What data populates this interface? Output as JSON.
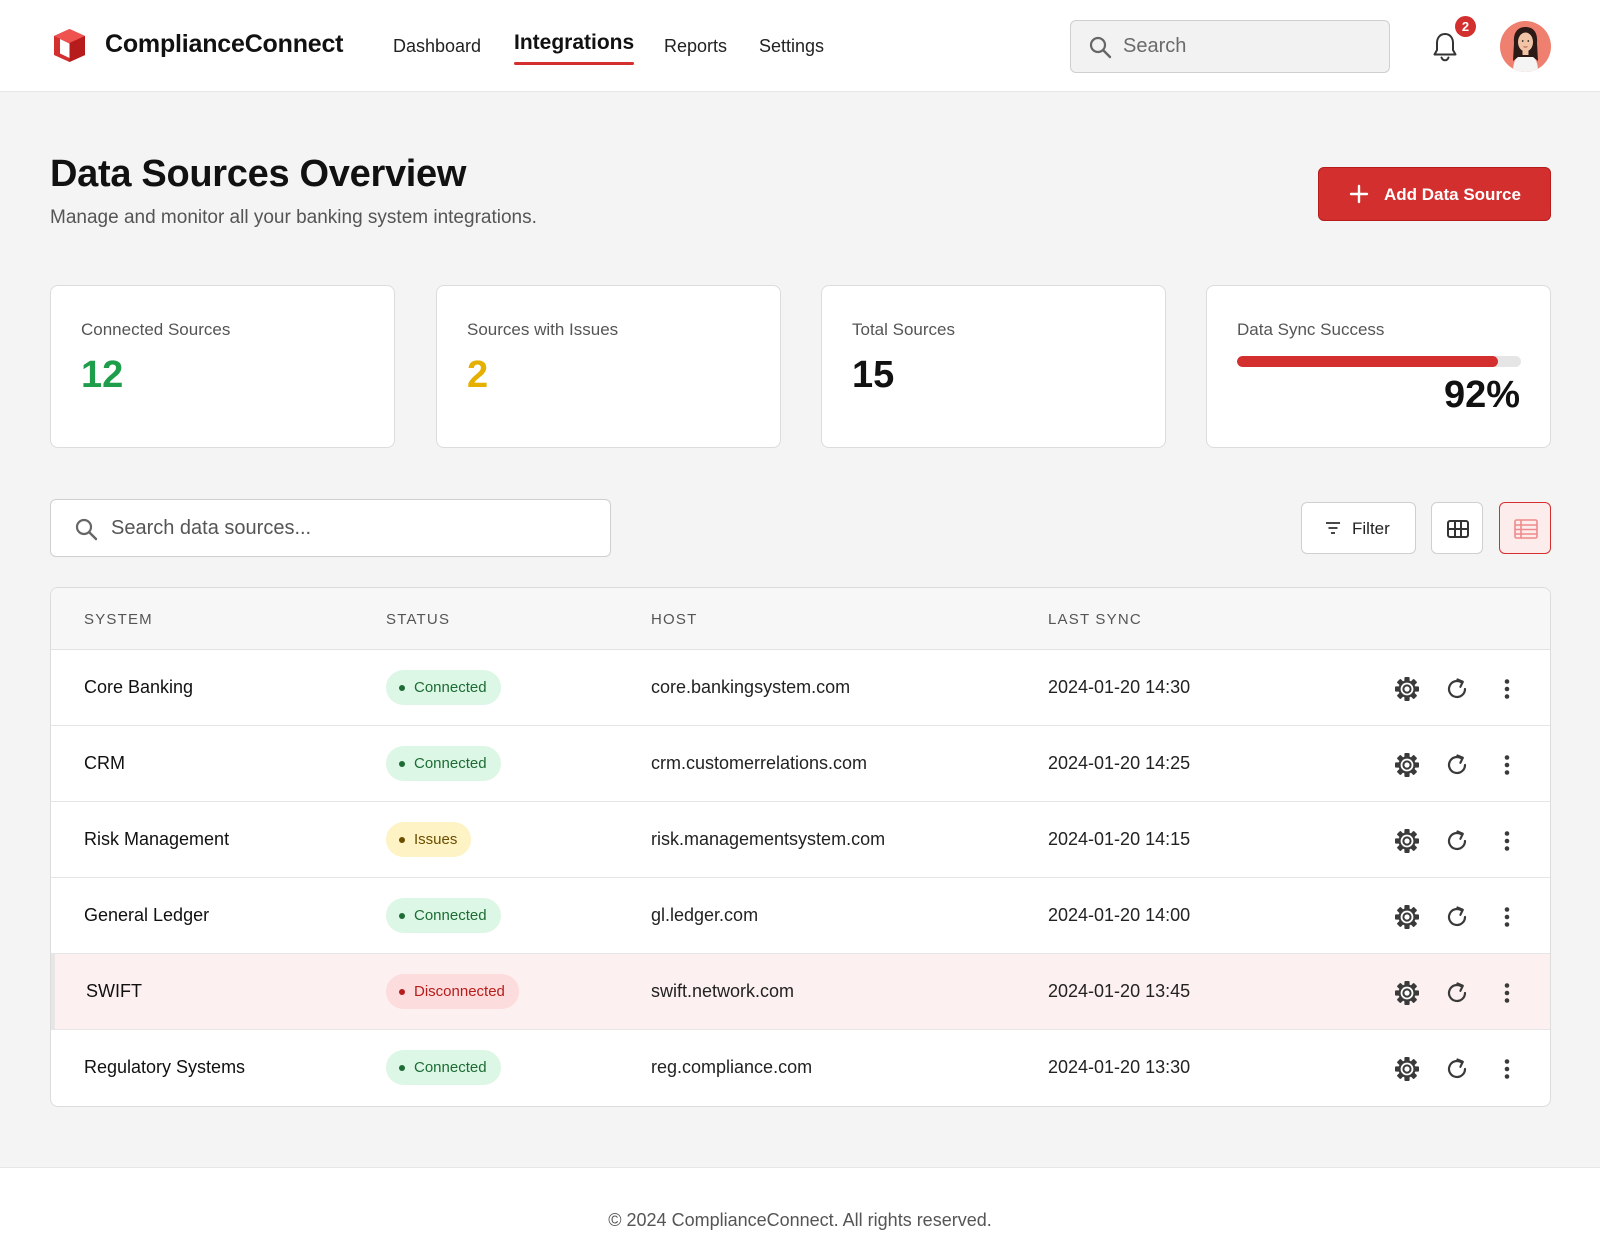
{
  "brand": {
    "name": "ComplianceConnect"
  },
  "nav": [
    {
      "label": "Dashboard"
    },
    {
      "label": "Integrations",
      "active": true
    },
    {
      "label": "Reports"
    },
    {
      "label": "Settings"
    }
  ],
  "header": {
    "search_placeholder": "Search",
    "notifications_count": "2"
  },
  "page": {
    "title": "Data Sources Overview",
    "subtitle": "Manage and monitor all your banking system integrations.",
    "add_button": "Add Data Source"
  },
  "stats": {
    "connected": {
      "label": "Connected Sources",
      "value": "12",
      "color": "#1e9e4a"
    },
    "issues": {
      "label": "Sources with Issues",
      "value": "2",
      "color": "#e6b000"
    },
    "total": {
      "label": "Total Sources",
      "value": "15",
      "color": "#111111"
    },
    "sync": {
      "label": "Data Sync Success",
      "value": "92%",
      "fraction": 0.92
    }
  },
  "toolbar": {
    "search_placeholder": "Search data sources...",
    "filter_label": "Filter"
  },
  "table": {
    "headers": {
      "system": "SYSTEM",
      "status": "STATUS",
      "host": "HOST",
      "sync": "LAST SYNC"
    },
    "rows": [
      {
        "system": "Core Banking",
        "status": "Connected",
        "host": "core.bankingsystem.com",
        "last_sync": "2024-01-20 14:30"
      },
      {
        "system": "CRM",
        "status": "Connected",
        "host": "crm.customerrelations.com",
        "last_sync": "2024-01-20 14:25"
      },
      {
        "system": "Risk Management",
        "status": "Issues",
        "host": "risk.managementsystem.com",
        "last_sync": "2024-01-20 14:15"
      },
      {
        "system": "General Ledger",
        "status": "Connected",
        "host": "gl.ledger.com",
        "last_sync": "2024-01-20 14:00"
      },
      {
        "system": "SWIFT",
        "status": "Disconnected",
        "host": "swift.network.com",
        "last_sync": "2024-01-20 13:45"
      },
      {
        "system": "Regulatory Systems",
        "status": "Connected",
        "host": "reg.compliance.com",
        "last_sync": "2024-01-20 13:30"
      }
    ]
  },
  "footer": {
    "text": "© 2024 ComplianceConnect. All rights reserved."
  },
  "colors": {
    "accent": "#d32f2f",
    "success": "#1e9e4a",
    "warning": "#e6b000"
  },
  "icons": [
    "logo-cube-icon",
    "search-icon",
    "bell-icon",
    "plus-icon",
    "filter-icon",
    "grid-view-icon",
    "table-view-icon",
    "gear-icon",
    "refresh-icon",
    "more-vertical-icon"
  ]
}
